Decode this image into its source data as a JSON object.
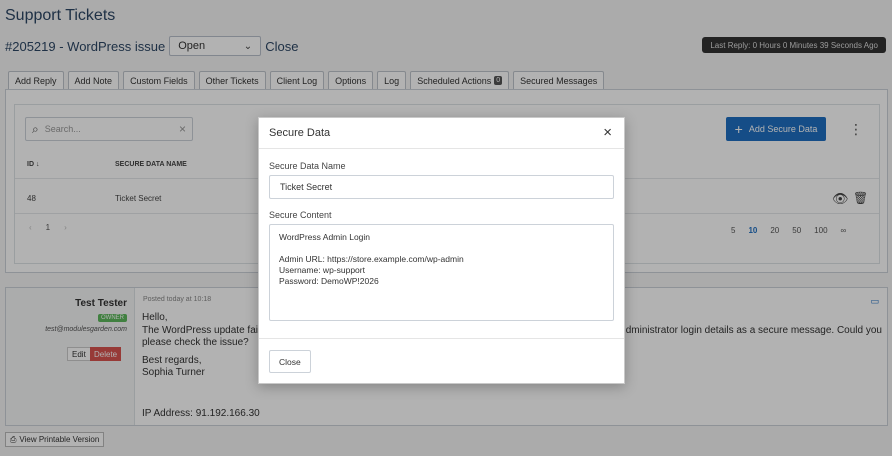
{
  "page": {
    "title": "Support Tickets",
    "ticket_title": "#205219 - WordPress issue",
    "status_value": "Open",
    "close_link": "Close",
    "last_reply": "Last Reply: 0 Hours 0 Minutes 39 Seconds Ago"
  },
  "tabs": [
    {
      "label": "Add Reply"
    },
    {
      "label": "Add Note"
    },
    {
      "label": "Custom Fields"
    },
    {
      "label": "Other Tickets"
    },
    {
      "label": "Client Log"
    },
    {
      "label": "Options"
    },
    {
      "label": "Log"
    },
    {
      "label": "Scheduled Actions",
      "badge": "0"
    },
    {
      "label": "Secured Messages"
    }
  ],
  "table": {
    "search_placeholder": "Search...",
    "add_button": "Add Secure Data",
    "columns": [
      "ID",
      "SECURE DATA NAME"
    ],
    "sort_indicator": "↓",
    "rows": [
      {
        "id": "48",
        "name": "Ticket Secret"
      }
    ],
    "pager": {
      "prev": "‹",
      "page": "1",
      "next": "›"
    },
    "page_sizes": [
      "5",
      "10",
      "20",
      "50",
      "100",
      "∞"
    ],
    "selected_page_size": "10"
  },
  "reply": {
    "author": "Test Tester",
    "role": "OWNER",
    "email": "test@modulesgarden.com",
    "edit_label": "Edit",
    "delete_label": "Delete",
    "posted": "Posted today at 10:18",
    "greeting": "Hello,",
    "body_left": "The WordPress update fails",
    "body_right": "dministrator login details as a secure message. Could you",
    "body_line2": "please check the issue?",
    "regards": "Best regards,",
    "signature": "Sophia Turner",
    "ip": "IP Address: 91.192.166.30"
  },
  "print_label": "View Printable Version",
  "modal": {
    "title": "Secure Data",
    "close_icon": "×",
    "name_label": "Secure Data Name",
    "name_value": "Ticket Secret",
    "content_label": "Secure Content",
    "content_value": "WordPress Admin Login\n\nAdmin URL: https://store.example.com/wp-admin\nUsername: wp-support\nPassword: DemoWP!2026",
    "close_button": "Close"
  },
  "colors": {
    "primary": "#1f6fc2",
    "danger": "#d9534f",
    "success": "#5cb85c",
    "overlay": "rgba(0,0,0,0.3)"
  }
}
